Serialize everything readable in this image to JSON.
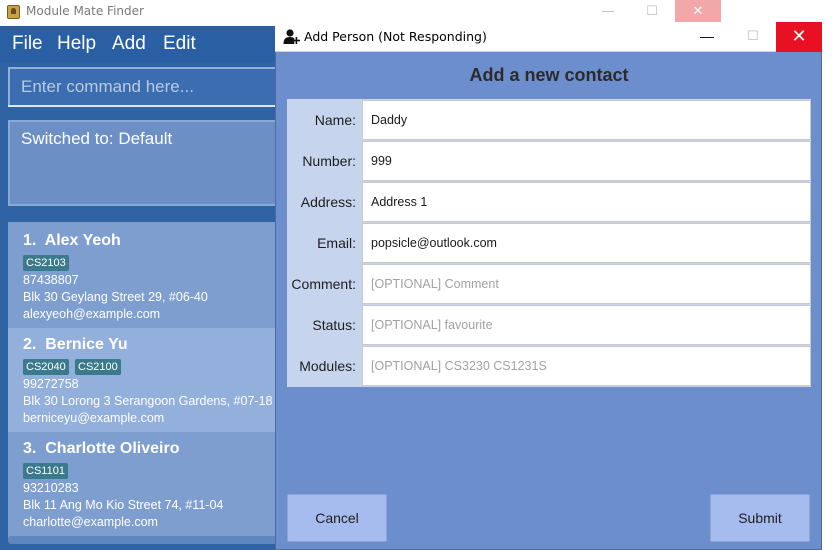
{
  "main_window": {
    "title": "Module Mate Finder",
    "controls": {
      "minimize": "—",
      "maximize": "☐",
      "close": "✕"
    },
    "menu": [
      "File",
      "Help",
      "Add",
      "Edit"
    ],
    "command_placeholder": "Enter command here...",
    "result_text": "Switched to: Default",
    "persons": [
      {
        "index": "1.",
        "name": "Alex Yeoh",
        "tags": [
          "CS2103"
        ],
        "phone": "87438807",
        "address": "Blk 30 Geylang Street 29, #06-40",
        "email": "alexyeoh@example.com"
      },
      {
        "index": "2.",
        "name": "Bernice Yu",
        "tags": [
          "CS2040",
          "CS2100"
        ],
        "phone": "99272758",
        "address": "Blk 30 Lorong 3 Serangoon Gardens, #07-18",
        "email": "berniceyu@example.com"
      },
      {
        "index": "3.",
        "name": "Charlotte Oliveiro",
        "tags": [
          "CS1101"
        ],
        "phone": "93210283",
        "address": "Blk 11 Ang Mo Kio Street 74, #11-04",
        "email": "charlotte@example.com"
      }
    ]
  },
  "dialog": {
    "title": "Add Person (Not Responding)",
    "icon": "add-person-icon",
    "controls": {
      "minimize": "—",
      "maximize": "☐",
      "close": "✕"
    },
    "heading": "Add a new contact",
    "fields": [
      {
        "label": "Name:",
        "value": "Daddy",
        "placeholder": ""
      },
      {
        "label": "Number:",
        "value": "999",
        "placeholder": ""
      },
      {
        "label": "Address:",
        "value": "Address 1",
        "placeholder": ""
      },
      {
        "label": "Email:",
        "value": "popsicle@outlook.com",
        "placeholder": ""
      },
      {
        "label": "Comment:",
        "value": "",
        "placeholder": "[OPTIONAL] Comment"
      },
      {
        "label": "Status:",
        "value": "",
        "placeholder": "[OPTIONAL] favourite"
      },
      {
        "label": "Modules:",
        "value": "",
        "placeholder": "[OPTIONAL] CS3230 CS1231S"
      }
    ],
    "cancel_label": "Cancel",
    "submit_label": "Submit"
  },
  "colors": {
    "main_bg": "#2f63a3",
    "dialog_bg": "#6d8ecc",
    "form_panel": "#c7d4ee",
    "button": "#a6bbee",
    "close_red": "#e81123",
    "tag": "#3b7a8c"
  }
}
